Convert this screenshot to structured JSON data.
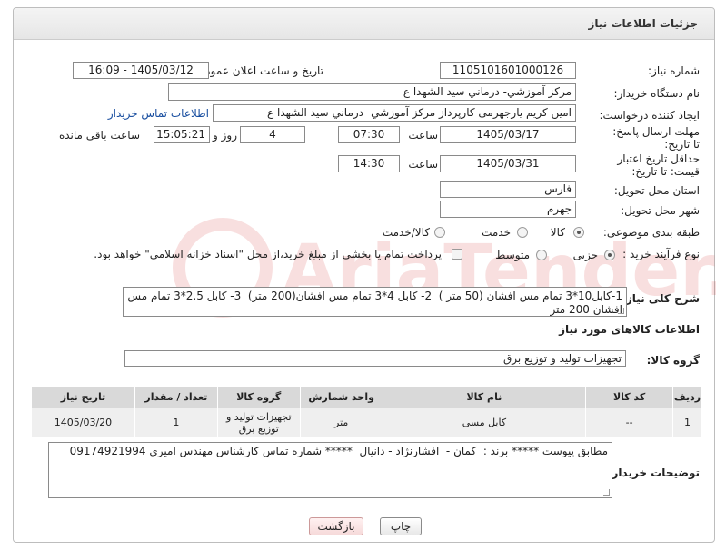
{
  "header": {
    "title": "جزئیات اطلاعات نیاز"
  },
  "fields": {
    "need_number_label": "شماره نیاز:",
    "need_number": "1105101601000126",
    "announce_label": "تاریخ و ساعت اعلان عمومی:",
    "announce_value": "1405/03/12 - 16:09",
    "buyer_org_label": "نام دستگاه خریدار:",
    "buyer_org": "مرکز آموزشي- درماني سيد الشهدا ع",
    "requester_label": "ایجاد کننده درخواست:",
    "requester": "امین کریم یارجهرمی کارپرداز مرکز آموزشي- درماني سيد الشهدا ع",
    "contact_link": "اطلاعات تماس خریدار",
    "reply_deadline_label": "مهلت ارسال پاسخ: تا تاریخ:",
    "reply_date": "1405/03/17",
    "time_label": "ساعت",
    "reply_time": "07:30",
    "days_value": "4",
    "days_label": "روز و",
    "remaining_time": "15:05:21",
    "remaining_label": "ساعت باقی مانده",
    "price_validity_label": "حداقل تاریخ اعتبار قیمت: تا تاریخ:",
    "validity_date": "1405/03/31",
    "validity_time": "14:30",
    "province_label": "استان محل تحویل:",
    "province": "فارس",
    "city_label": "شهر محل تحویل:",
    "city": "جهرم",
    "category_label": "طبقه بندی موضوعی:",
    "category_options": [
      "کالا",
      "خدمت",
      "کالا/خدمت"
    ],
    "process_label": "نوع فرآیند خرید :",
    "process_options": [
      "جزیی",
      "متوسط"
    ],
    "payment_note": "پرداخت تمام یا بخشی از مبلغ خرید،از محل \"اسناد خزانه اسلامی\" خواهد بود.",
    "summary_label": "شرح کلی نیاز:",
    "summary": "1-کابل10*3 تمام مس افشان (50 متر )  2- کابل 4*3 تمام مس افشان(200 متر)  3- کابل 2.5*3 تمام مس افشان 200 متر",
    "goods_info_title": "اطلاعات کالاهای مورد نیاز",
    "goods_group_label": "گروه کالا:",
    "goods_group": "تجهیزات تولید و توزیع برق",
    "buyer_notes_label": "توضیحات خریدار:",
    "buyer_notes": "مطابق پیوست ***** برند :  کمان -  افشارنژاد - دانیال  ***** شماره تماس کارشناس مهندس امیری 09174921994"
  },
  "table": {
    "headers": [
      "ردیف",
      "کد کالا",
      "نام کالا",
      "واحد شمارش",
      "گروه کالا",
      "تعداد / مقدار",
      "تاریخ نیاز"
    ],
    "rows": [
      [
        "1",
        "--",
        "کابل مسی",
        "متر",
        "تجهیزات تولید و توزیع برق",
        "1",
        "1405/03/20"
      ]
    ]
  },
  "buttons": {
    "print": "چاپ",
    "back": "بازگشت"
  },
  "watermark": "AriaTender.neT"
}
